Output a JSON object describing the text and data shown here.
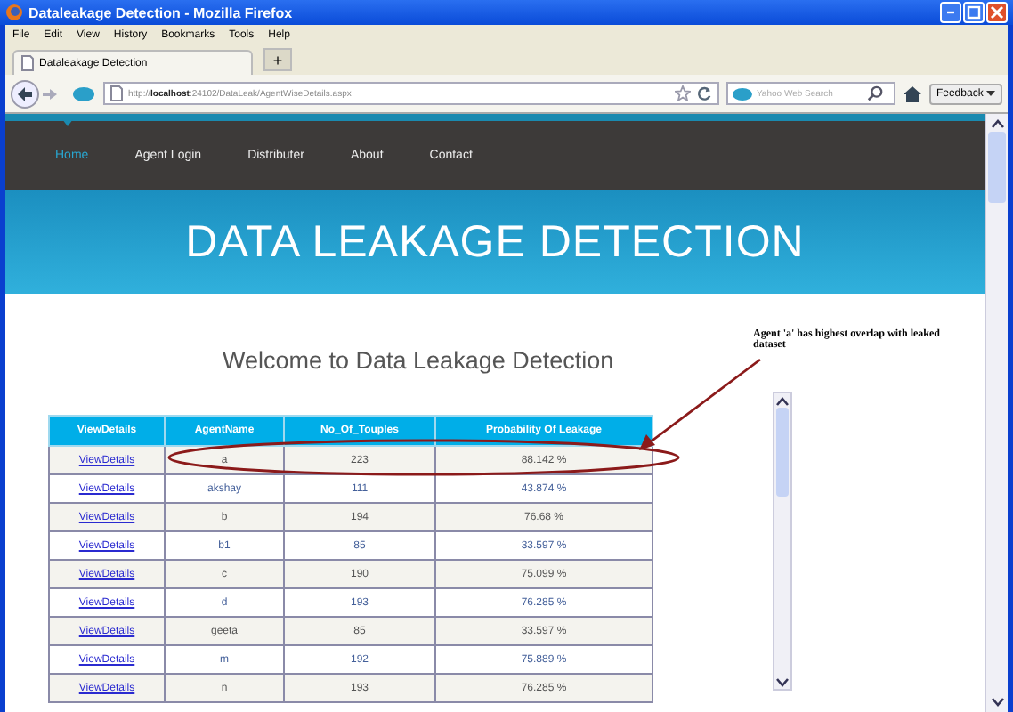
{
  "window": {
    "title": "Dataleakage Detection - Mozilla Firefox"
  },
  "menu": [
    "File",
    "Edit",
    "View",
    "History",
    "Bookmarks",
    "Tools",
    "Help"
  ],
  "tabs": [
    {
      "label": "Dataleakage Detection",
      "selected": true
    }
  ],
  "new_tab": "+",
  "address": "http://**localhost**:24102/DataLeak/AgentWiseDetails.aspx",
  "search": {
    "placeholder": "Yahoo Web Search"
  },
  "feedback": "Feedback",
  "nav": [
    {
      "label": "Home",
      "selected": true
    },
    {
      "label": "Agent Login",
      "selected": false
    },
    {
      "label": "Distributer",
      "selected": false
    },
    {
      "label": "About",
      "selected": false
    },
    {
      "label": "Contact",
      "selected": false
    }
  ],
  "banner": "DATA LEAKAGE DETECTION",
  "heading": "Welcome to Data Leakage Detection",
  "table": {
    "columns": [
      "ViewDetails",
      "AgentName",
      "No_Of_Touples",
      "Probability Of Leakage"
    ],
    "rows": [
      {
        "link": "ViewDetails",
        "agent": "a",
        "tuples": "223",
        "probability": "88.142 %",
        "circled": true
      },
      {
        "link": "ViewDetails",
        "agent": "akshay",
        "tuples": "111",
        "probability": "43.874 %",
        "circled": false
      },
      {
        "link": "ViewDetails",
        "agent": "b",
        "tuples": "194",
        "probability": "76.68 %",
        "circled": false
      },
      {
        "link": "ViewDetails",
        "agent": "b1",
        "tuples": "85",
        "probability": "33.597 %",
        "circled": false
      },
      {
        "link": "ViewDetails",
        "agent": "c",
        "tuples": "190",
        "probability": "75.099 %",
        "circled": false
      },
      {
        "link": "ViewDetails",
        "agent": "d",
        "tuples": "193",
        "probability": "76.285 %",
        "circled": false
      },
      {
        "link": "ViewDetails",
        "agent": "geeta",
        "tuples": "85",
        "probability": "33.597 %",
        "circled": false
      },
      {
        "link": "ViewDetails",
        "agent": "m",
        "tuples": "192",
        "probability": "75.889 %",
        "circled": false
      },
      {
        "link": "ViewDetails",
        "agent": "n",
        "tuples": "193",
        "probability": "76.285 %",
        "circled": false
      }
    ]
  },
  "annotation": "Agent 'a' has highest overlap with leaked dataset"
}
